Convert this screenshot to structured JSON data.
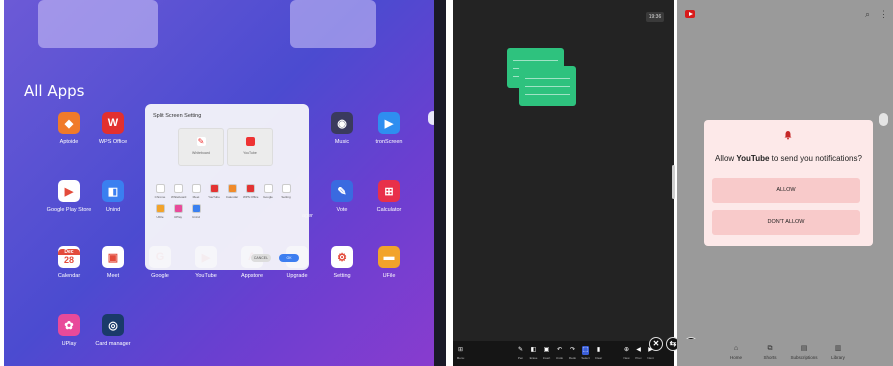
{
  "left_panel": {
    "title": "All Apps",
    "apps": [
      {
        "label": "Aptoide",
        "icon": "aptoide-icon",
        "color": "#f07a2a",
        "glyph": "◆"
      },
      {
        "label": "WPS Office",
        "icon": "wps-office-icon",
        "color": "#e2302f",
        "glyph": "W"
      },
      {
        "label": "Music",
        "icon": "music-icon",
        "color": "#3a3a5e",
        "glyph": "◉"
      },
      {
        "label": "tronScreen",
        "icon": "tronscreen-icon",
        "color": "#2e8ef0",
        "glyph": "▶"
      },
      {
        "label": "Google Play Store",
        "icon": "play-store-icon",
        "color": "#ffffff",
        "glyph": "▶"
      },
      {
        "label": "Unind",
        "icon": "unind-icon",
        "color": "#3a7ff0",
        "glyph": "◧"
      },
      {
        "label": "Vote",
        "icon": "vote-icon",
        "color": "#3a6ae0",
        "glyph": "✎"
      },
      {
        "label": "Calculator",
        "icon": "calculator-icon",
        "color": "#e8304a",
        "glyph": "⊞"
      },
      {
        "label": "Calendar",
        "icon": "calendar-icon",
        "color": "#ffffff",
        "glyph": "28",
        "cal_top": "Dec"
      },
      {
        "label": "Meet",
        "icon": "meet-icon",
        "color": "#ffffff",
        "glyph": "▣"
      },
      {
        "label": "Google",
        "icon": "google-icon",
        "color": "#ffffff",
        "glyph": "G"
      },
      {
        "label": "YouTube",
        "icon": "youtube-icon",
        "color": "#ffffff",
        "glyph": "▶"
      },
      {
        "label": "Appstore",
        "icon": "appstore-icon",
        "color": "#ffffff",
        "glyph": "A"
      },
      {
        "label": "Upgrade",
        "icon": "upgrade-icon",
        "color": "#ffffff",
        "glyph": "↑"
      },
      {
        "label": "Setting",
        "icon": "setting-icon",
        "color": "#ffffff",
        "glyph": "⚙"
      },
      {
        "label": "UFile",
        "icon": "ufile-icon",
        "color": "#f2a32a",
        "glyph": "▬"
      },
      {
        "label": "UPlay",
        "icon": "uplay-icon",
        "color": "#e84a9a",
        "glyph": "✿"
      },
      {
        "label": "Card manager",
        "icon": "card-manager-icon",
        "color": "#1a3a6a",
        "glyph": "◎"
      }
    ],
    "partial_label": "ager",
    "dialog": {
      "title": "Split Screen Setting",
      "left_preview": "Whiteboard",
      "right_preview": "YouTube",
      "mini_apps": [
        "Chrome",
        "Whiteboard",
        "Meet",
        "YouTube",
        "Calendar",
        "WPS Office",
        "Google",
        "Setting",
        "UFile",
        "UPlay",
        "Unind"
      ],
      "cancel": "CANCEL",
      "ok": "OK"
    }
  },
  "mid_panel": {
    "clock": "19:36",
    "tools": [
      "Pen",
      "Erase",
      "Insert",
      "Undo",
      "Redo",
      "Select",
      "Clear",
      "New",
      "Prev",
      "Next"
    ],
    "menu_label": "Menu",
    "close_glyph": "✕",
    "swap_glyph": "⇆"
  },
  "right_panel": {
    "close_glyph": "✕",
    "search_icon": "search-icon",
    "notification": {
      "prefix": "Allow ",
      "app": "YouTube",
      "suffix": " to send you notifications?",
      "allow": "ALLOW",
      "deny": "DON'T ALLOW"
    },
    "nav": [
      "Home",
      "Shorts",
      "Subscriptions",
      "Library"
    ]
  }
}
